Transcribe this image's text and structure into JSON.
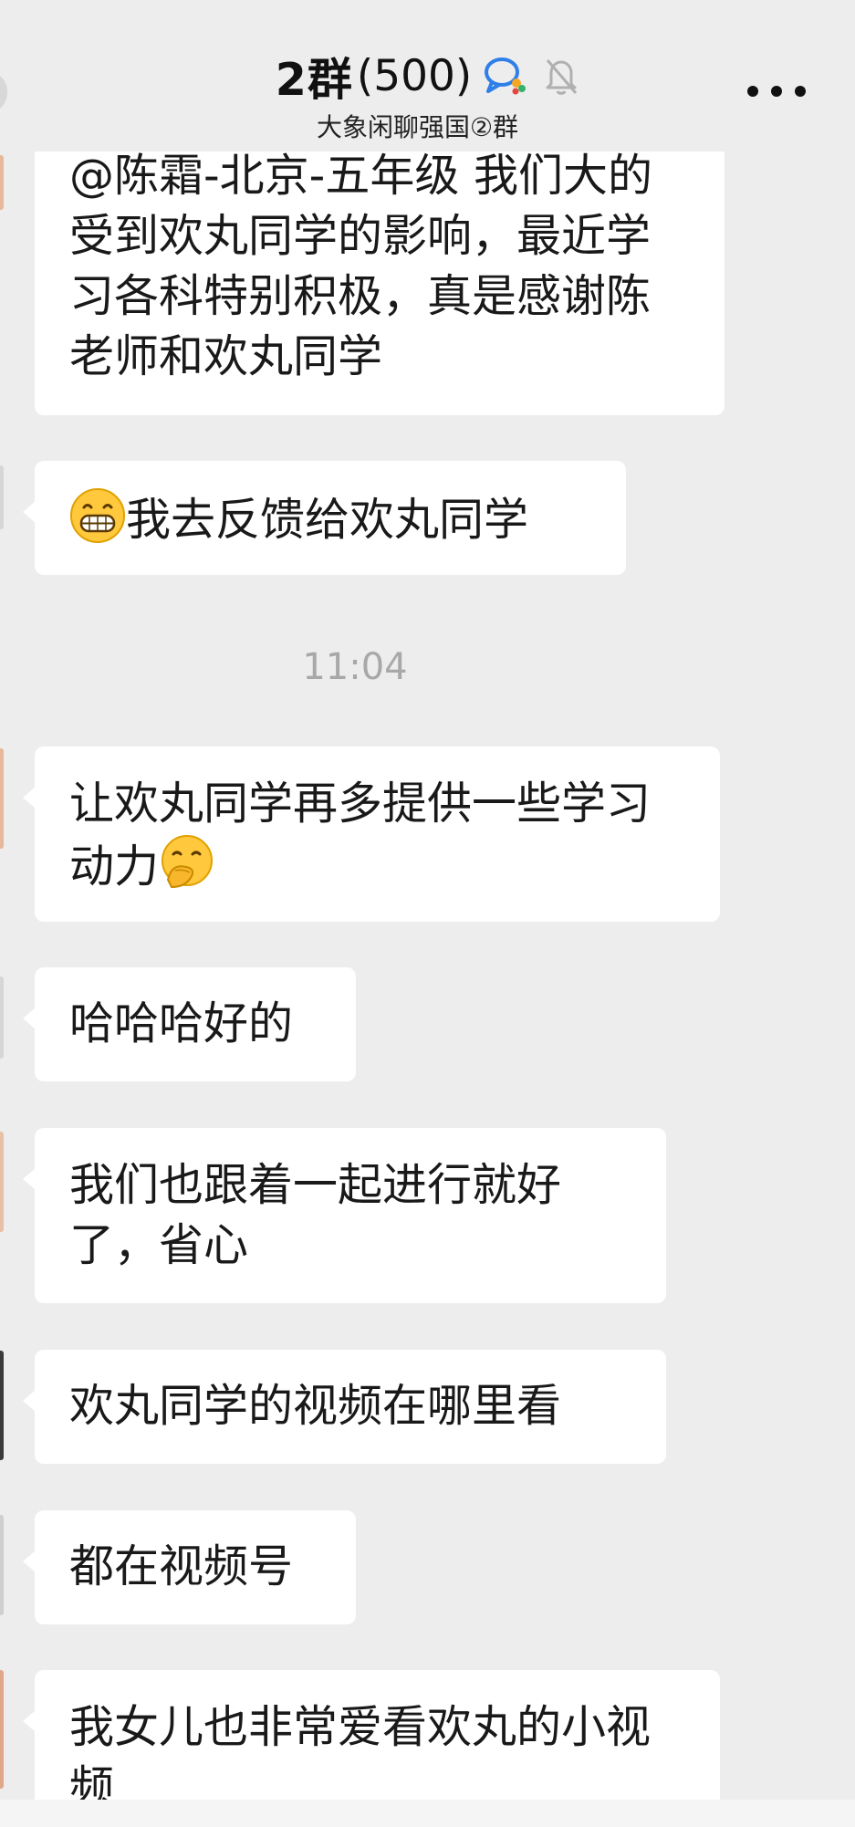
{
  "header": {
    "group_name": "2群",
    "member_count": "(500)",
    "subtitle": "大象闲聊强国②群"
  },
  "timestamp": "11:04",
  "messages": [
    {
      "text": "@陈霜-北京-五年级 我们大的受到欢丸同学的影响，最近学习各科特别积极，真是感谢陈老师和欢丸同学"
    },
    {
      "text": "我去反馈给欢丸同学",
      "emoji": "grinning-face"
    },
    {
      "text": "让欢丸同学再多提供一些学习动力",
      "emoji": "face-with-hand-over-mouth"
    },
    {
      "text": "哈哈哈好的"
    },
    {
      "text": "我们也跟着一起进行就好了，省心"
    },
    {
      "text": "欢丸同学的视频在哪里看"
    },
    {
      "text": "都在视频号"
    },
    {
      "text": "我女儿也非常爱看欢丸的小视频"
    }
  ],
  "colors": {
    "background": "#ededed",
    "bubble": "#ffffff",
    "text": "#191919",
    "timestamp": "#a8a8a8",
    "chat_icon_blue": "#2f7fe8"
  }
}
